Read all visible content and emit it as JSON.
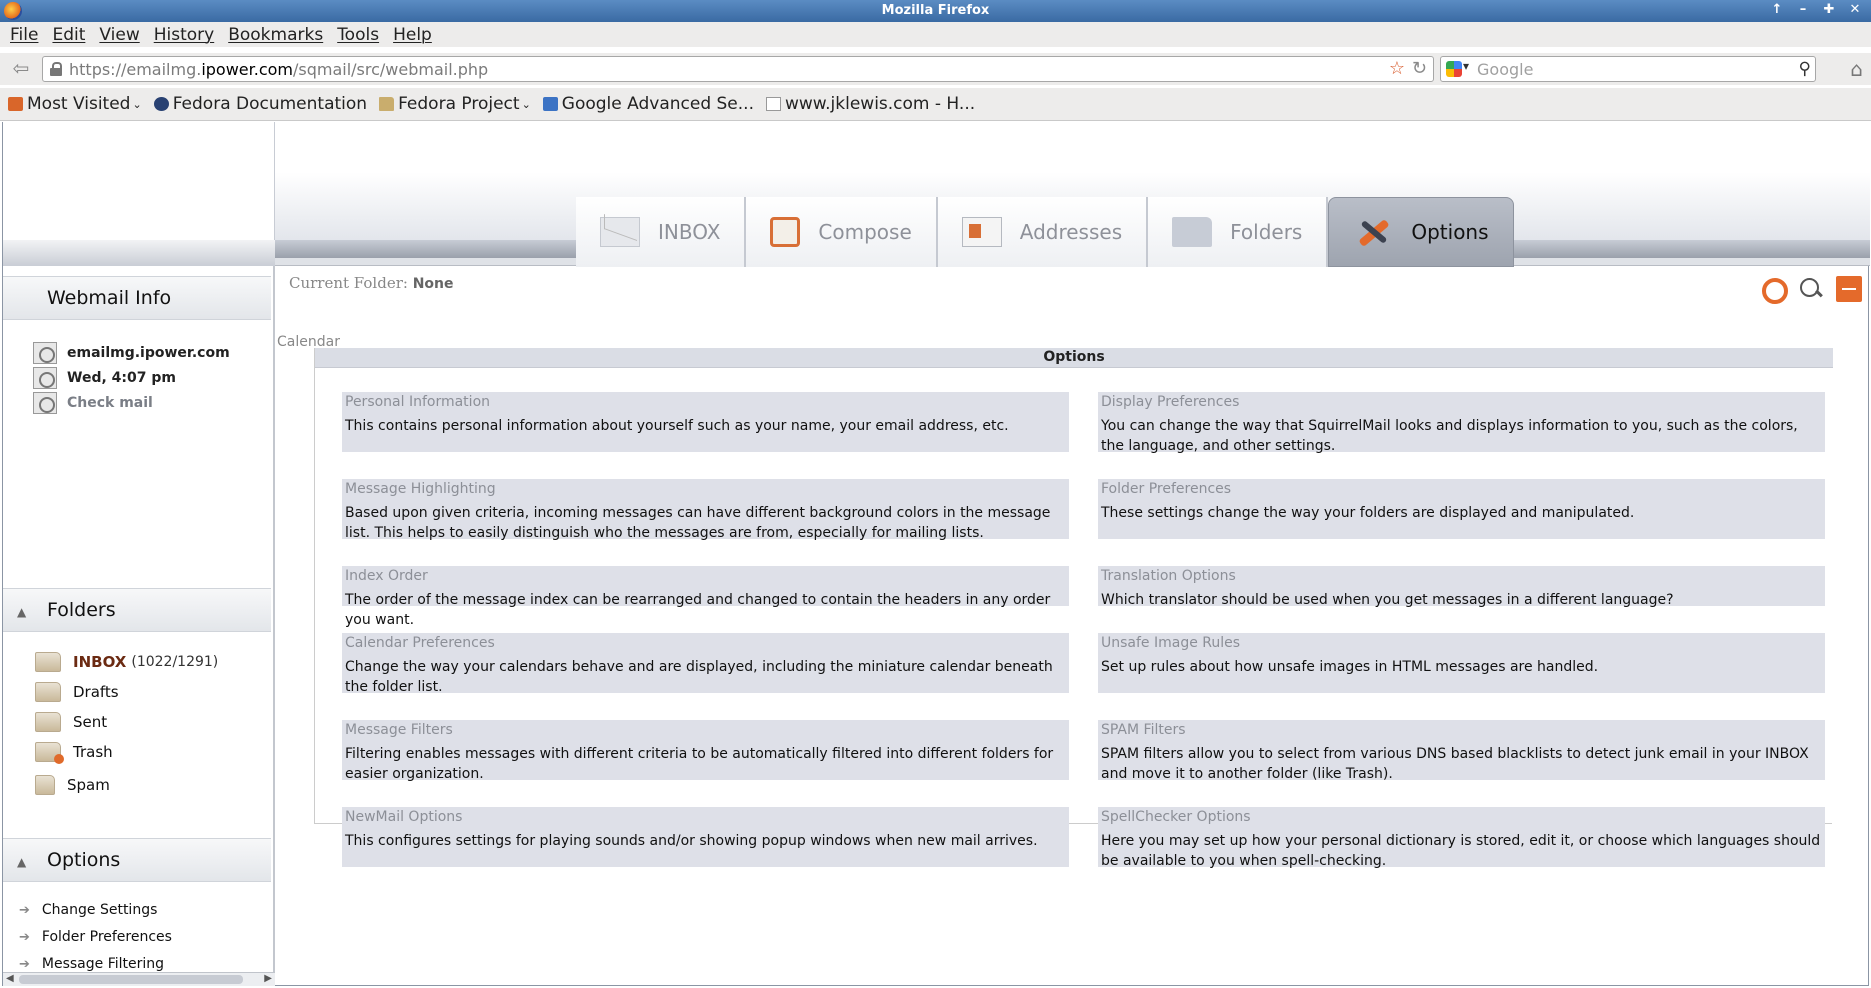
{
  "window": {
    "title": "Mozilla Firefox",
    "controls": [
      "↑",
      "–",
      "✚",
      "✕"
    ]
  },
  "menubar": {
    "items": [
      "File",
      "Edit",
      "View",
      "History",
      "Bookmarks",
      "Tools",
      "Help"
    ]
  },
  "navbar": {
    "url_prefix": "https://emailmg.",
    "url_host": "ipower.com",
    "url_suffix": "/sqmail/src/webmail.php",
    "search_placeholder": "Google"
  },
  "bookmarks": [
    {
      "label": "Most Visited",
      "icon": "most-visited-icon",
      "dropdown": true
    },
    {
      "label": "Fedora Documentation",
      "icon": "fedora-icon",
      "dropdown": false
    },
    {
      "label": "Fedora Project",
      "icon": "folder-icon",
      "dropdown": true
    },
    {
      "label": "Google Advanced Se...",
      "icon": "google-icon",
      "dropdown": false
    },
    {
      "label": "www.jklewis.com - H...",
      "icon": "page-icon",
      "dropdown": false
    }
  ],
  "tabs": [
    {
      "label": "INBOX",
      "icon": "mail-icon",
      "active": false
    },
    {
      "label": "Compose",
      "icon": "compose-icon",
      "active": false
    },
    {
      "label": "Addresses",
      "icon": "addressbook-icon",
      "active": false
    },
    {
      "label": "Folders",
      "icon": "folder-icon",
      "active": false
    },
    {
      "label": "Options",
      "icon": "tools-icon",
      "active": true
    }
  ],
  "sidebar": {
    "info": {
      "heading": "Webmail Info",
      "server": "emailmg.ipower.com",
      "time": "Wed, 4:07 pm",
      "check_mail": "Check mail"
    },
    "folders": {
      "heading": "Folders",
      "items": [
        {
          "label": "INBOX",
          "count": "(1022/1291)"
        },
        {
          "label": "Drafts",
          "count": ""
        },
        {
          "label": "Sent",
          "count": ""
        },
        {
          "label": "Trash",
          "count": ""
        },
        {
          "label": "Spam",
          "count": ""
        }
      ]
    },
    "options": {
      "heading": "Options",
      "items": [
        "Change Settings",
        "Folder Preferences",
        "Message Filtering"
      ]
    }
  },
  "main": {
    "current_folder_label": "Current Folder:",
    "current_folder_value": "None",
    "calendar_link": "Calendar",
    "options_title": "Options",
    "cards": [
      {
        "title": "Personal Information",
        "desc": "This contains personal information about yourself such as your name, your email address, etc."
      },
      {
        "title": "Display Preferences",
        "desc": "You can change the way that SquirrelMail looks and displays information to you, such as the colors, the language, and other settings."
      },
      {
        "title": "Message Highlighting",
        "desc": "Based upon given criteria, incoming messages can have different background colors in the message list. This helps to easily distinguish who the messages are from, especially for mailing lists."
      },
      {
        "title": "Folder Preferences",
        "desc": "These settings change the way your folders are displayed and manipulated."
      },
      {
        "title": "Index Order",
        "desc": "The order of the message index can be rearranged and changed to contain the headers in any order you want."
      },
      {
        "title": "Translation Options",
        "desc": "Which translator should be used when you get messages in a different language?"
      },
      {
        "title": "Calendar Preferences",
        "desc": "Change the way your calendars behave and are displayed, including the miniature calendar beneath the folder list."
      },
      {
        "title": "Unsafe Image Rules",
        "desc": "Set up rules about how unsafe images in HTML messages are handled."
      },
      {
        "title": "Message Filters",
        "desc": "Filtering enables messages with different criteria to be automatically filtered into different folders for easier organization."
      },
      {
        "title": "SPAM Filters",
        "desc": "SPAM filters allow you to select from various DNS based blacklists to detect junk email in your INBOX and move it to another folder (like Trash)."
      },
      {
        "title": "NewMail Options",
        "desc": "This configures settings for playing sounds and/or showing popup windows when new mail arrives."
      },
      {
        "title": "SpellChecker Options",
        "desc": "Here you may set up how your personal dictionary is stored, edit it, or choose which languages should be available to you when spell-checking."
      }
    ]
  },
  "colors": {
    "accent": "#e46a2b",
    "card_bg": "#dee0e8",
    "titlebar": "#4a7bb3"
  }
}
